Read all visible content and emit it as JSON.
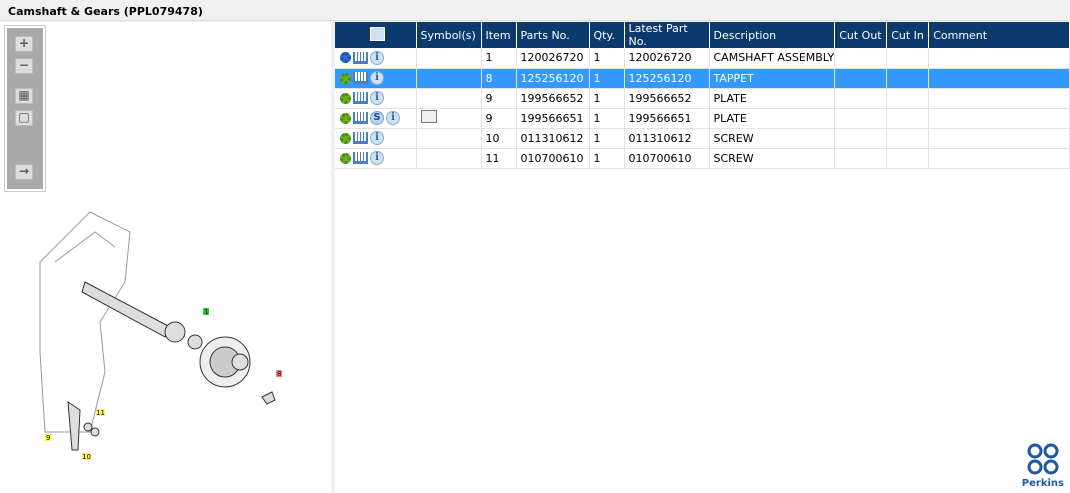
{
  "title": "Camshaft & Gears (PPL079478)",
  "toolbar": {
    "zoom_in": "+",
    "zoom_out": "−"
  },
  "diagram": {
    "callouts": [
      {
        "label": "1",
        "color": "#33cc33"
      },
      {
        "label": "8",
        "color": "#ff8080"
      },
      {
        "label": "9",
        "color": "#ffff33"
      },
      {
        "label": "10",
        "color": "#ffff33"
      },
      {
        "label": "11",
        "color": "#ffff33"
      }
    ]
  },
  "table": {
    "headers": [
      "",
      "Symbol(s)",
      "Item",
      "Parts No.",
      "Qty.",
      "Latest Part No.",
      "Description",
      "Cut Out",
      "Cut In",
      "Comment"
    ],
    "rows": [
      {
        "item": "1",
        "part": "120026720",
        "qty": "1",
        "latest": "120026720",
        "desc": "CAMSHAFT ASSEMBLY",
        "selected": false
      },
      {
        "item": "8",
        "part": "125256120",
        "qty": "1",
        "latest": "125256120",
        "desc": "TAPPET",
        "selected": true
      },
      {
        "item": "9",
        "part": "199566652",
        "qty": "1",
        "latest": "199566652",
        "desc": "PLATE",
        "selected": false
      },
      {
        "item": "9",
        "part": "199566651",
        "qty": "1",
        "latest": "199566651",
        "desc": "PLATE",
        "selected": false
      },
      {
        "item": "10",
        "part": "011310612",
        "qty": "1",
        "latest": "011310612",
        "desc": "SCREW",
        "selected": false
      },
      {
        "item": "11",
        "part": "010700610",
        "qty": "1",
        "latest": "010700610",
        "desc": "SCREW",
        "selected": false
      }
    ]
  },
  "icons": {
    "info": "i",
    "s": "S"
  },
  "logo": {
    "text": "Perkins"
  }
}
